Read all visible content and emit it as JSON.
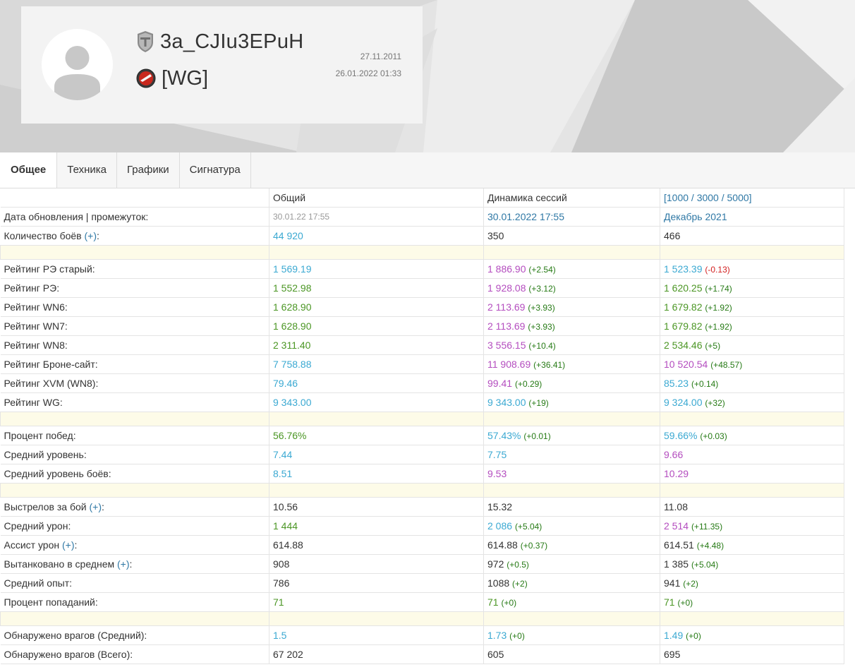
{
  "header": {
    "player_name": "3a_CJIu3EPuH",
    "clan_tag": "[WG]",
    "registered": "27.11.2011",
    "last_battle": "26.01.2022 01:33",
    "icons": [
      "avatar-placeholder-icon",
      "wot-tank-icon",
      "clan-emblem-icon"
    ]
  },
  "tabs": [
    {
      "label": "Общее",
      "active": true
    },
    {
      "label": "Техника"
    },
    {
      "label": "Графики"
    },
    {
      "label": "Сигнатура"
    }
  ],
  "columns": {
    "total": "Общий",
    "session": "Динамика сессий",
    "range": "[1000 / 3000 / 5000]"
  },
  "rows": {
    "update": {
      "label": "Дата обновления | промежуток:",
      "total": "30.01.22 17:55",
      "session": "30.01.2022 17:55",
      "range": "Декабрь 2021"
    },
    "battles": {
      "label": "Количество боёв",
      "plus": "(+)",
      "suffix": ":",
      "total": "44 920",
      "session": "350",
      "range": "466"
    },
    "re_old": {
      "label": "Рейтинг РЭ старый:",
      "total": "1 569.19",
      "session": "1 886.90",
      "session_d": "(+2.54)",
      "range": "1 523.39",
      "range_d": "(-0.13)"
    },
    "re": {
      "label": "Рейтинг РЭ:",
      "total": "1 552.98",
      "session": "1 928.08",
      "session_d": "(+3.12)",
      "range": "1 620.25",
      "range_d": "(+1.74)"
    },
    "wn6": {
      "label": "Рейтинг WN6:",
      "total": "1 628.90",
      "session": "2 113.69",
      "session_d": "(+3.93)",
      "range": "1 679.82",
      "range_d": "(+1.92)"
    },
    "wn7": {
      "label": "Рейтинг WN7:",
      "total": "1 628.90",
      "session": "2 113.69",
      "session_d": "(+3.93)",
      "range": "1 679.82",
      "range_d": "(+1.92)"
    },
    "wn8": {
      "label": "Рейтинг WN8:",
      "total": "2 311.40",
      "session": "3 556.15",
      "session_d": "(+10.4)",
      "range": "2 534.46",
      "range_d": "(+5)"
    },
    "brone": {
      "label": "Рейтинг Броне-сайт:",
      "total": "7 758.88",
      "session": "11 908.69",
      "session_d": "(+36.41)",
      "range": "10 520.54",
      "range_d": "(+48.57)"
    },
    "xvm": {
      "label": "Рейтинг XVM (WN8):",
      "total": "79.46",
      "session": "99.41",
      "session_d": "(+0.29)",
      "range": "85.23",
      "range_d": "(+0.14)"
    },
    "wg": {
      "label": "Рейтинг WG:",
      "total": "9 343.00",
      "session": "9 343.00",
      "session_d": "(+19)",
      "range": "9 324.00",
      "range_d": "(+32)"
    },
    "winrate": {
      "label": "Процент побед:",
      "total": "56.76%",
      "session": "57.43%",
      "session_d": "(+0.01)",
      "range": "59.66%",
      "range_d": "(+0.03)"
    },
    "avg_tier": {
      "label": "Средний уровень:",
      "total": "7.44",
      "session": "7.75",
      "range": "9.66"
    },
    "avg_battle_tier": {
      "label": "Средний уровень боёв:",
      "total": "8.51",
      "session": "9.53",
      "range": "10.29"
    },
    "shots": {
      "label": "Выстрелов за бой",
      "plus": "(+)",
      "suffix": ":",
      "total": "10.56",
      "session": "15.32",
      "range": "11.08"
    },
    "avg_damage": {
      "label": "Средний урон:",
      "total": "1 444",
      "session": "2 086",
      "session_d": "(+5.04)",
      "range": "2 514",
      "range_d": "(+11.35)"
    },
    "assist": {
      "label": "Ассист урон",
      "plus": "(+)",
      "suffix": ":",
      "total": "614.88",
      "session": "614.88",
      "session_d": "(+0.37)",
      "range": "614.51",
      "range_d": "(+4.48)"
    },
    "tanked": {
      "label": "Вытанковано в среднем",
      "plus": "(+)",
      "suffix": ":",
      "total": "908",
      "session": "972",
      "session_d": "(+0.5)",
      "range": "1 385",
      "range_d": "(+5.04)"
    },
    "avg_xp": {
      "label": "Средний опыт:",
      "total": "786",
      "session": "1088",
      "session_d": "(+2)",
      "range": "941",
      "range_d": "(+2)"
    },
    "hit_rate": {
      "label": "Процент попаданий:",
      "total": "71",
      "session": "71",
      "session_d": "(+0)",
      "range": "71",
      "range_d": "(+0)"
    },
    "spotted_avg": {
      "label": "Обнаружено врагов (Средний):",
      "total": "1.5",
      "session": "1.73",
      "session_d": "(+0)",
      "range": "1.49",
      "range_d": "(+0)"
    },
    "spotted_total": {
      "label": "Обнаружено врагов (Всего):",
      "total": "67 202",
      "session": "605",
      "range": "695"
    }
  },
  "colors": {
    "blue": "#3ba9d2",
    "green": "#4b9624",
    "purple": "#b44dbf",
    "delta_pos": "#267a15",
    "delta_neg": "#d22020",
    "link": "#2f78a5",
    "gap_row": "#fdfbe8"
  }
}
